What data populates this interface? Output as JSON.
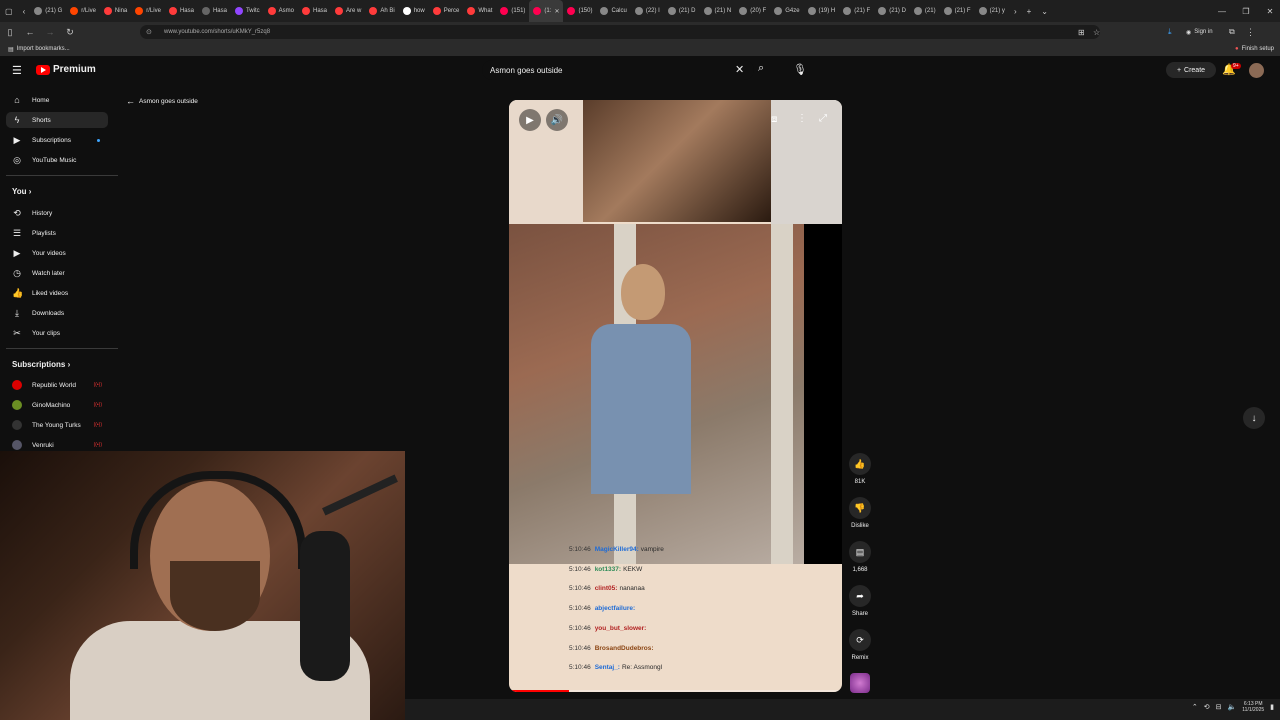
{
  "browser": {
    "tabs": [
      {
        "label": "(21) G",
        "color": "#888"
      },
      {
        "label": "r/Live",
        "color": "#ff4500"
      },
      {
        "label": "Nina",
        "color": "#ff3b3b"
      },
      {
        "label": "r/Live",
        "color": "#ff4500"
      },
      {
        "label": "Hasa",
        "color": "#ff3b3b"
      },
      {
        "label": "Hasa",
        "color": "#666"
      },
      {
        "label": "Twitc",
        "color": "#9146ff"
      },
      {
        "label": "Asmo",
        "color": "#ff3b3b"
      },
      {
        "label": "Hasa",
        "color": "#ff3b3b"
      },
      {
        "label": "Are w",
        "color": "#ff3b3b"
      },
      {
        "label": "Ah Bi",
        "color": "#ff3b3b"
      },
      {
        "label": "how",
        "color": "#fff"
      },
      {
        "label": "Perce",
        "color": "#ff3b3b"
      },
      {
        "label": "What",
        "color": "#ff3b3b"
      },
      {
        "label": "(151)",
        "color": "#ff0050"
      },
      {
        "label": "(1:",
        "color": "#ff0050",
        "active": true
      },
      {
        "label": "(150)",
        "color": "#ff0050"
      },
      {
        "label": "Calcu",
        "color": "#888"
      },
      {
        "label": "(22) I",
        "color": "#888"
      },
      {
        "label": "(21) D",
        "color": "#888"
      },
      {
        "label": "(21) N",
        "color": "#888"
      },
      {
        "label": "(20) F",
        "color": "#888"
      },
      {
        "label": "G4ze",
        "color": "#888"
      },
      {
        "label": "(19) H",
        "color": "#888"
      },
      {
        "label": "(21) F",
        "color": "#888"
      },
      {
        "label": "(21) D",
        "color": "#888"
      },
      {
        "label": "(21)",
        "color": "#888"
      },
      {
        "label": "(21) F",
        "color": "#888"
      },
      {
        "label": "(21) y",
        "color": "#888"
      }
    ],
    "url": "www.youtube.com/shorts/uKMkY_r5zq8",
    "signin": "Sign in",
    "bookmark_import": "Import bookmarks...",
    "finish_setup": "Finish setup"
  },
  "youtube": {
    "logo_text": "Premium",
    "search_query": "Asmon goes outside",
    "create_label": "Create",
    "notif_count": "9+",
    "shorts_title": "Asmon goes outside",
    "sidebar": {
      "main": [
        "Home",
        "Shorts",
        "Subscriptions",
        "YouTube Music"
      ],
      "you_header": "You",
      "you_items": [
        "History",
        "Playlists",
        "Your videos",
        "Watch later",
        "Liked videos",
        "Downloads",
        "Your clips"
      ],
      "subs_header": "Subscriptions",
      "subs": [
        {
          "name": "Republic World",
          "color": "#d00"
        },
        {
          "name": "GinoMachino",
          "color": "#6b8e23"
        },
        {
          "name": "The Young Turks",
          "color": "#333"
        },
        {
          "name": "Venruki",
          "color": "#556"
        }
      ]
    },
    "actions": {
      "likes": "81K",
      "dislike": "Dislike",
      "comments": "1,668",
      "share": "Share",
      "remix": "Remix"
    },
    "chat": [
      {
        "time": "5:10:46",
        "user": "MagicKiller94:",
        "msg": "vampire",
        "color": "#1e6bd6"
      },
      {
        "time": "5:10:46",
        "user": "kot1337:",
        "msg": "KEKW",
        "color": "#2e8b57"
      },
      {
        "time": "5:10:46",
        "user": "clint05:",
        "msg": "nananaa",
        "color": "#b22222"
      },
      {
        "time": "5:10:46",
        "user": "abjectfailure:",
        "msg": "",
        "color": "#1e6bd6"
      },
      {
        "time": "5:10:46",
        "user": "you_but_slower:",
        "msg": "",
        "color": "#b22222"
      },
      {
        "time": "5:10:46",
        "user": "BrosandDudebros:",
        "msg": "",
        "color": "#8b4513"
      },
      {
        "time": "5:10:46",
        "user": "Sentaj_:",
        "msg": "Re: Assmongl",
        "color": "#1e6bd6"
      }
    ],
    "progress": 0.18
  },
  "system": {
    "time": "6:13 PM",
    "date": "11/1/2025"
  }
}
